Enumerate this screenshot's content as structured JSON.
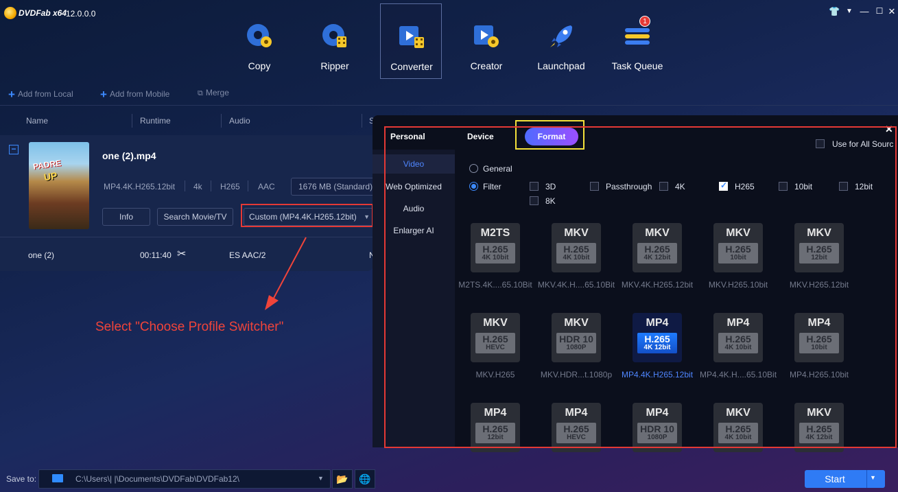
{
  "app": {
    "name": "DVDFab x64",
    "version": "12.0.0.0"
  },
  "window_controls": [
    "shirt-icon",
    "minimize-menu-icon",
    "minimize-icon",
    "maximize-icon",
    "close-icon"
  ],
  "nav": [
    {
      "id": "copy",
      "label": "Copy"
    },
    {
      "id": "ripper",
      "label": "Ripper"
    },
    {
      "id": "converter",
      "label": "Converter",
      "active": true
    },
    {
      "id": "creator",
      "label": "Creator"
    },
    {
      "id": "launchpad",
      "label": "Launchpad"
    },
    {
      "id": "taskqueue",
      "label": "Task Queue",
      "badge": "1"
    }
  ],
  "toolbar": {
    "add_local": "Add from Local",
    "add_mobile": "Add from Mobile",
    "merge": "Merge"
  },
  "columns": {
    "name": "Name",
    "runtime": "Runtime",
    "audio": "Audio",
    "subtitle": "S"
  },
  "title": {
    "filename": "one (2).mp4",
    "meta": [
      "MP4.4K.H265.12bit",
      "4k",
      "H265",
      "AAC"
    ],
    "size": "1676 MB (Standard)",
    "info_btn": "Info",
    "search_btn": "Search Movie/TV",
    "profile": "Custom (MP4.4K.H265.12bit)",
    "poster_text": [
      "PADRE",
      "UP"
    ]
  },
  "subrow": {
    "name": "one (2)",
    "runtime": "00:11:40",
    "audio": "ES AAC/2",
    "subtitle": "N"
  },
  "annotation": "Select \"Choose Profile Switcher\"",
  "popup": {
    "tabs": {
      "personal": "Personal",
      "device": "Device",
      "format": "Format"
    },
    "use_all": "Use for All Sourc",
    "sidebar": [
      "Video",
      "Web Optimized",
      "Audio",
      "Enlarger AI"
    ],
    "mode": {
      "general": "General",
      "filter": "Filter"
    },
    "filters": [
      {
        "label": "3D",
        "checked": false
      },
      {
        "label": "Passthrough",
        "checked": false
      },
      {
        "label": "4K",
        "checked": false
      },
      {
        "label": "H265",
        "checked": true
      },
      {
        "label": "10bit",
        "checked": false
      },
      {
        "label": "12bit",
        "checked": false
      },
      {
        "label": "8K",
        "checked": false
      }
    ],
    "tiles": [
      {
        "fmt": "M2TS",
        "c1": "H.265",
        "c2": "4K 10bit",
        "label": "M2TS.4K....65.10Bit"
      },
      {
        "fmt": "MKV",
        "c1": "H.265",
        "c2": "4K 10bit",
        "label": "MKV.4K.H....65.10Bit"
      },
      {
        "fmt": "MKV",
        "c1": "H.265",
        "c2": "4K 12bit",
        "label": "MKV.4K.H265.12bit"
      },
      {
        "fmt": "MKV",
        "c1": "H.265",
        "c2": "10bit",
        "label": "MKV.H265.10bit"
      },
      {
        "fmt": "MKV",
        "c1": "H.265",
        "c2": "12bit",
        "label": "MKV.H265.12bit"
      },
      {
        "fmt": "MKV",
        "c1": "H.265",
        "c2": "HEVC",
        "label": "MKV.H265"
      },
      {
        "fmt": "MKV",
        "c1": "HDR 10",
        "c2": "1080P",
        "label": "MKV.HDR...t.1080p"
      },
      {
        "fmt": "MP4",
        "c1": "H.265",
        "c2": "4K 12bit",
        "label": "MP4.4K.H265.12bit",
        "selected": true
      },
      {
        "fmt": "MP4",
        "c1": "H.265",
        "c2": "4K 10bit",
        "label": "MP4.4K.H....65.10Bit"
      },
      {
        "fmt": "MP4",
        "c1": "H.265",
        "c2": "10bit",
        "label": "MP4.H265.10bit"
      },
      {
        "fmt": "MP4",
        "c1": "H.265",
        "c2": "12bit",
        "label": ""
      },
      {
        "fmt": "MP4",
        "c1": "H.265",
        "c2": "HEVC",
        "label": ""
      },
      {
        "fmt": "MP4",
        "c1": "HDR 10",
        "c2": "1080P",
        "label": ""
      },
      {
        "fmt": "MKV",
        "c1": "H.265",
        "c2": "4K 10bit",
        "label": ""
      },
      {
        "fmt": "MKV",
        "c1": "H.265",
        "c2": "4K 12bit",
        "label": ""
      }
    ]
  },
  "bottom": {
    "save_to": "Save to:",
    "path": "C:\\Users\\|            |\\Documents\\DVDFab\\DVDFab12\\",
    "start": "Start"
  }
}
